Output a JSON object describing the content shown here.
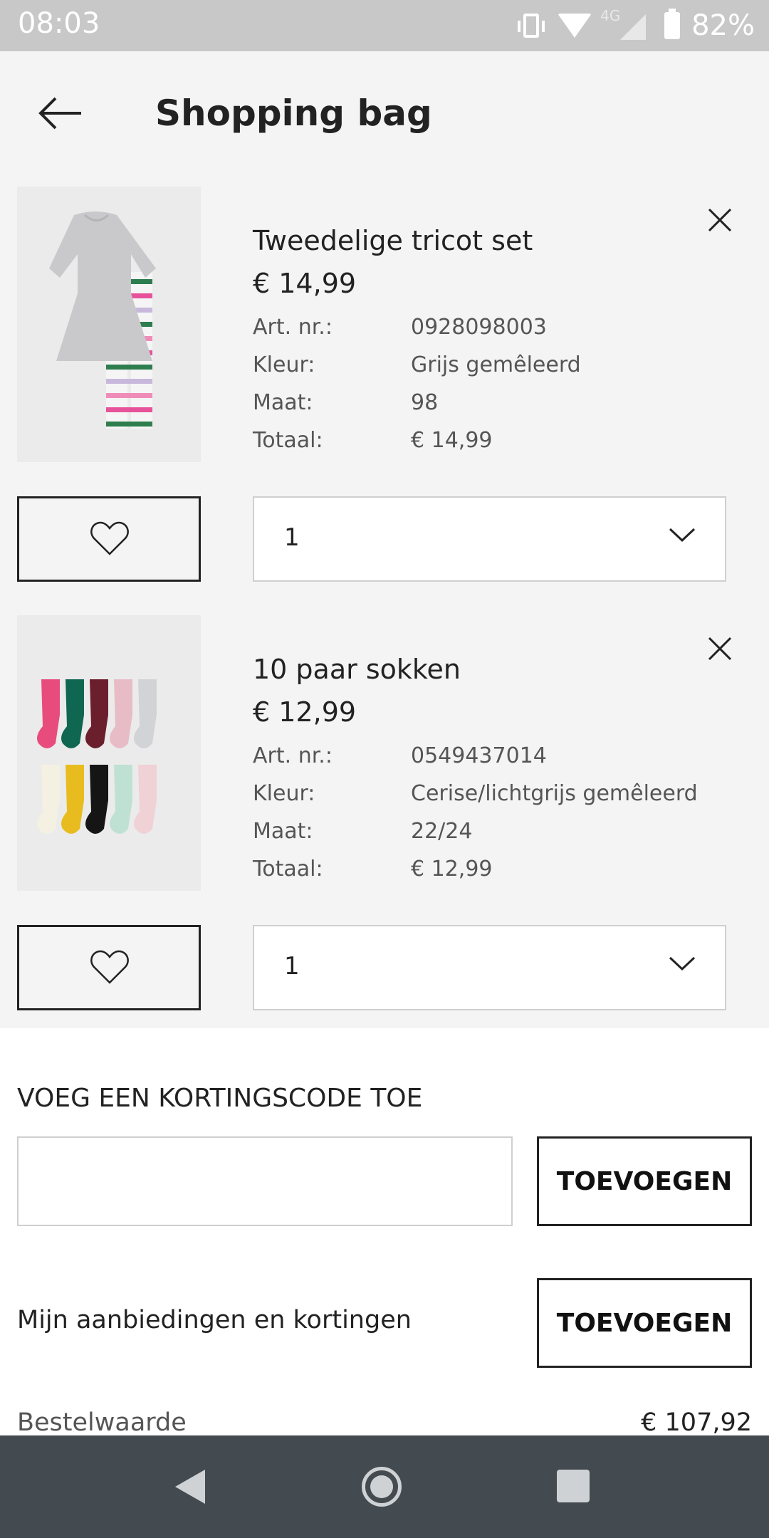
{
  "status_bar": {
    "time": "08:03",
    "network": "4G",
    "battery": "82%"
  },
  "header": {
    "title": "Shopping bag",
    "back_icon": "arrow-left-icon"
  },
  "labels": {
    "art_nr": "Art. nr.:",
    "kleur": "Kleur:",
    "maat": "Maat:",
    "totaal": "Totaal:"
  },
  "products": [
    {
      "name": "Tweedelige tricot set",
      "price": "€ 14,99",
      "art_nr": "0928098003",
      "kleur": "Grijs gemêleerd",
      "maat": "98",
      "totaal": "€ 14,99",
      "quantity": "1"
    },
    {
      "name": "10 paar sokken",
      "price": "€ 12,99",
      "art_nr": "0549437014",
      "kleur": "Cerise/lichtgrijs gemêleerd",
      "maat": "22/24",
      "totaal": "€ 12,99",
      "quantity": "1"
    }
  ],
  "discount": {
    "heading": "VOEG EEN KORTINGSCODE TOE",
    "input_value": "",
    "button_label": "TOEVOEGEN"
  },
  "offers": {
    "label": "Mijn aanbiedingen en kortingen",
    "button_label": "TOEVOEGEN"
  },
  "summary": {
    "order_value_label": "Bestelwaarde",
    "order_value": "€ 107,92"
  },
  "colors": {
    "background": "#f4f4f4",
    "text": "#222222",
    "border": "#222222",
    "nav_bar": "#434a50"
  }
}
